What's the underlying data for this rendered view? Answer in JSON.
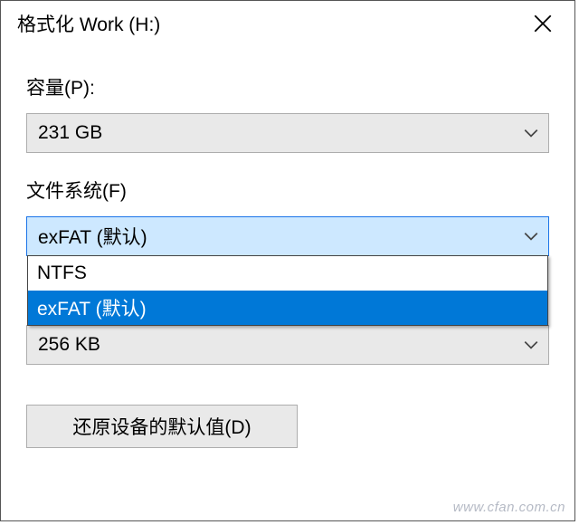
{
  "dialog": {
    "title": "格式化 Work (H:)"
  },
  "capacity": {
    "label": "容量(P):",
    "value": "231 GB"
  },
  "filesystem": {
    "label": "文件系统(F)",
    "selected": "exFAT (默认)",
    "options": {
      "ntfs": "NTFS",
      "exfat": "exFAT (默认)"
    }
  },
  "allocation": {
    "value": "256 KB"
  },
  "restore": {
    "label": "还原设备的默认值(D)"
  },
  "watermark": "www.cfan.com.cn"
}
